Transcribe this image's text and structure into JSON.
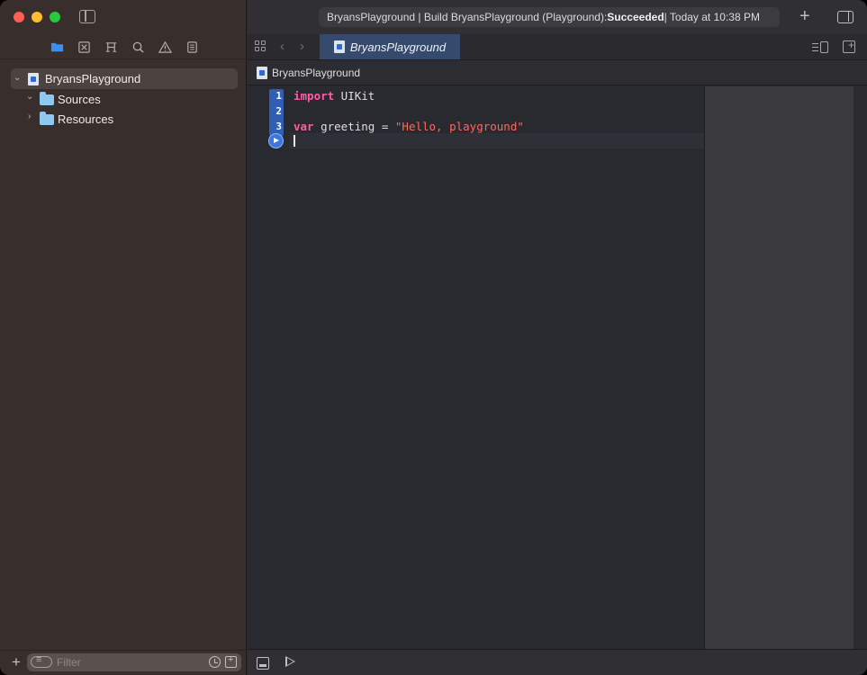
{
  "toolbar": {
    "activity_prefix": "BryansPlayground | Build BryansPlayground (Playground): ",
    "activity_status": "Succeeded",
    "activity_suffix": " | Today at 10:38 PM"
  },
  "navigator": {
    "tabs": [
      "folder-icon",
      "source-control-icon",
      "symbol-icon",
      "find-icon",
      "issue-icon",
      "report-icon"
    ],
    "active_tab": "folder-icon",
    "items": [
      {
        "label": "BryansPlayground",
        "type": "playground",
        "expanded": true,
        "selected": true
      },
      {
        "label": "Sources",
        "type": "folder",
        "expanded": true,
        "selected": false
      },
      {
        "label": "Resources",
        "type": "folder",
        "expanded": false,
        "selected": false
      }
    ],
    "filter_placeholder": "Filter"
  },
  "editor": {
    "tab_label": "BryansPlayground",
    "jump_bar": "BryansPlayground",
    "line_numbers": [
      "1",
      "2",
      "3"
    ],
    "code": {
      "line1_keyword": "import",
      "line1_rest": " UIKit",
      "line3_keyword": "var",
      "line3_mid": " greeting = ",
      "line3_string": "\"Hello, playground\""
    }
  },
  "colors": {
    "accent": "#2f5fb3",
    "keyword": "#fc5fa3",
    "string": "#fc6a5d",
    "sidebar_bg": "#382e2c",
    "editor_bg": "#292a30"
  }
}
